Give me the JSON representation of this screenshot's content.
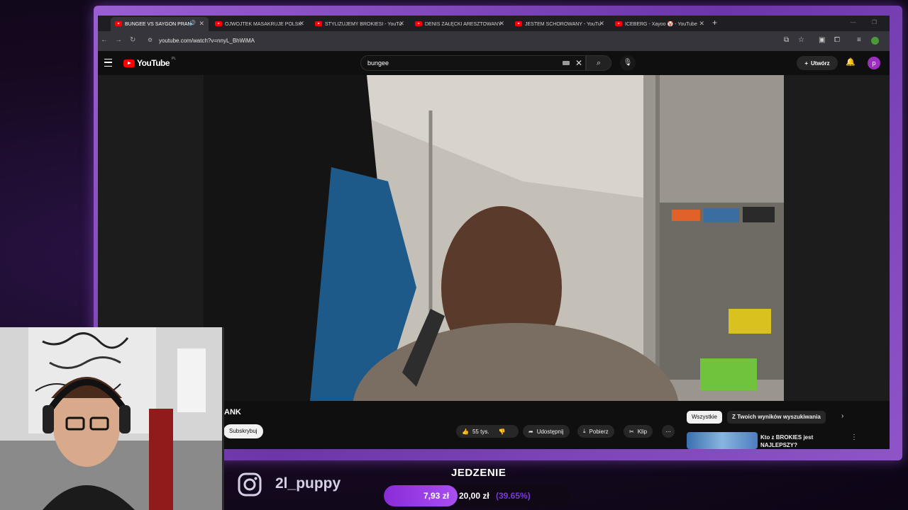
{
  "tabs": [
    {
      "label": "BUNGEE VS SAYGON PRAN",
      "active": true,
      "audio": true
    },
    {
      "label": "OJWOJTEK MASAKRUJE POLSK"
    },
    {
      "label": "STYLIZUJEMY BROKIESI - YouTu"
    },
    {
      "label": "DENIS ZAŁĘCKI ARESZTOWANY"
    },
    {
      "label": "JESTEM SCHOROWANY - YouTu"
    },
    {
      "label": "ICEBERG - Xayoo 🤡 - YouTube"
    }
  ],
  "address": {
    "url": "youtube.com/watch?v=nnyL_BhWiMA"
  },
  "youtube": {
    "logo_text": "YouTube",
    "country_code": "PL",
    "search_value": "bungee",
    "create_label": "Utwórz",
    "avatar_letter": "p"
  },
  "video": {
    "title_fragment": "ANK",
    "subscribe_label": "Subskrybuj",
    "like_count": "55 tys.",
    "share_label": "Udostępnij",
    "download_label": "Pobierz",
    "clip_label": "Klip"
  },
  "filters": {
    "all": "Wszystkie",
    "from_search": "Z Twoich wyników wyszukiwania"
  },
  "related": {
    "title": "Kto z BROKIES jest NAJLEPSZY?"
  },
  "stream": {
    "instagram_handle": "2l_puppy",
    "goal_title": "JEDZENIE",
    "goal_current": "7,93 zł",
    "goal_target": "20,00 zł",
    "goal_percent": "(39.65%)",
    "goal_fraction": 0.3965
  },
  "colors": {
    "accent": "#9b4de8",
    "yt_red": "#ff0000"
  }
}
